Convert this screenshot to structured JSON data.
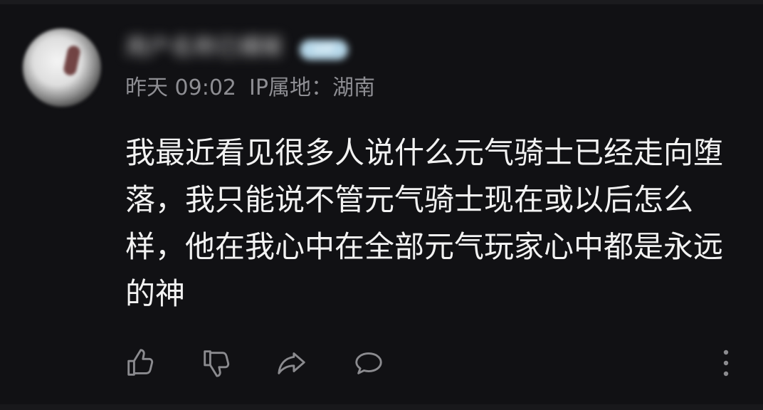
{
  "comment_card": {
    "username": "用户名称已模糊",
    "user_badge": "VIP",
    "timestamp": "昨天 09:02",
    "ip_location": "IP属地：湖南",
    "body": "我最近看见很多人说什么元气骑士已经走向堕落，我只能说不管元气骑士现在或以后怎么样，他在我心中在全部元气玩家心中都是永远的神"
  },
  "actions": {
    "like_icon": "thumbs-up-icon",
    "dislike_icon": "thumbs-down-icon",
    "share_icon": "share-icon",
    "reply_icon": "comment-icon",
    "more_icon": "more-vertical-icon"
  },
  "colors": {
    "background": "#111114",
    "text_primary": "#f2f2f2",
    "text_secondary": "#8e8e93",
    "icon": "#8b8b8f"
  }
}
